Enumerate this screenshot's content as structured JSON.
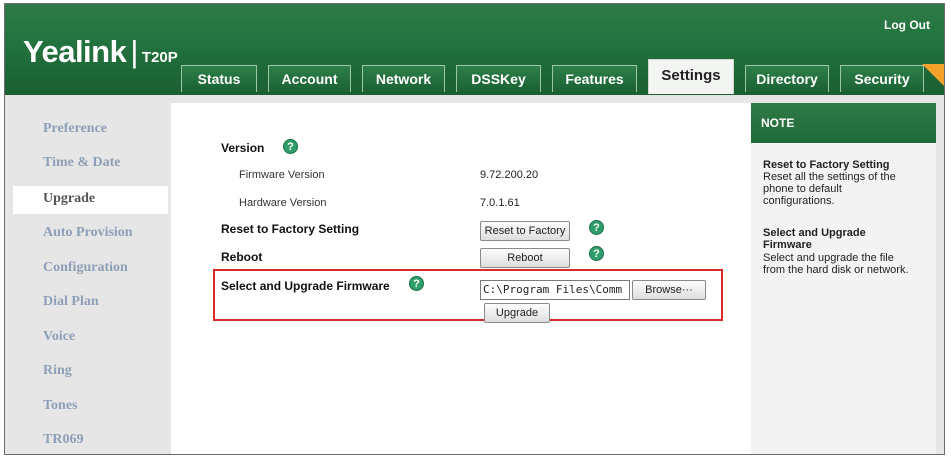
{
  "header": {
    "brand": "Yealink",
    "separator": "|",
    "model": "T20P",
    "logout": "Log Out"
  },
  "tabs": [
    {
      "label": "Status",
      "active": false
    },
    {
      "label": "Account",
      "active": false
    },
    {
      "label": "Network",
      "active": false
    },
    {
      "label": "DSSKey",
      "active": false
    },
    {
      "label": "Features",
      "active": false
    },
    {
      "label": "Settings",
      "active": true
    },
    {
      "label": "Directory",
      "active": false
    },
    {
      "label": "Security",
      "active": false
    }
  ],
  "sidebar": {
    "items": [
      {
        "label": "Preference"
      },
      {
        "label": "Time & Date"
      },
      {
        "label": "Upgrade",
        "active": true
      },
      {
        "label": "Auto Provision"
      },
      {
        "label": "Configuration"
      },
      {
        "label": "Dial Plan"
      },
      {
        "label": "Voice"
      },
      {
        "label": "Ring"
      },
      {
        "label": "Tones"
      },
      {
        "label": "TR069"
      }
    ]
  },
  "main": {
    "version_label": "Version",
    "firmware_label": "Firmware Version",
    "firmware_value": "9.72.200.20",
    "hardware_label": "Hardware Version",
    "hardware_value": "7.0.1.61",
    "reset_label": "Reset to Factory Setting",
    "reset_button": "Reset to Factory",
    "reboot_label": "Reboot",
    "reboot_button": "Reboot",
    "upgrade_label": "Select and Upgrade Firmware",
    "file_path_value": "C:\\Program Files\\Comm",
    "browse_button": "Browse···",
    "upgrade_button": "Upgrade",
    "help_glyph": "?"
  },
  "note": {
    "heading": "NOTE",
    "entries": [
      {
        "title": "Reset to Factory Setting",
        "lines": [
          "Reset all the settings of the",
          "phone to default",
          "configurations."
        ]
      },
      {
        "title_lines": [
          "Select and Upgrade",
          "Firmware"
        ],
        "lines": [
          "Select and upgrade the file",
          "from the hard disk or network."
        ]
      }
    ]
  },
  "colors": {
    "header_green": "#237540",
    "accent_orange": "#f3a22b",
    "highlight_red": "#d92b2b",
    "help_icon_green": "#2f9e6a",
    "sidebar_link": "#8da0b8"
  }
}
